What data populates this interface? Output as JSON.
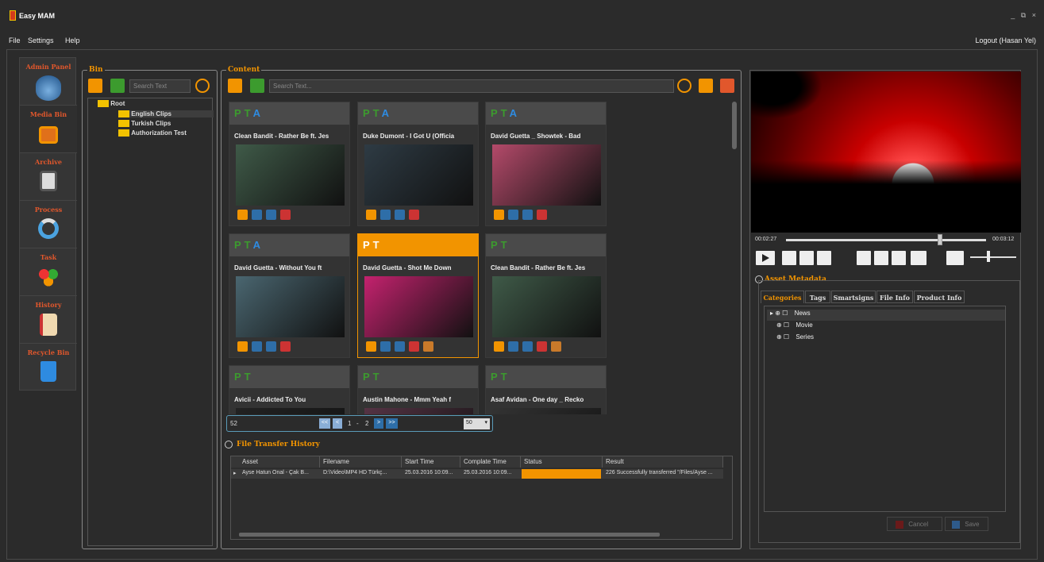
{
  "app": {
    "title": "Easy MAM",
    "window_controls": [
      "_",
      "⧉",
      "×"
    ]
  },
  "menu": {
    "items": [
      "File",
      "Settings",
      "Help"
    ],
    "logout": "Logout (Hasan Yel)"
  },
  "nav": {
    "items": [
      {
        "label": "Admin Panel",
        "icon": "admin-icon"
      },
      {
        "label": "Media Bin",
        "icon": "media-bin-icon"
      },
      {
        "label": "Archive",
        "icon": "archive-icon"
      },
      {
        "label": "Process",
        "icon": "process-icon"
      },
      {
        "label": "Task",
        "icon": "task-icon"
      },
      {
        "label": "History",
        "icon": "history-icon"
      },
      {
        "label": "Recycle Bin",
        "icon": "trash-icon"
      }
    ]
  },
  "bin": {
    "title": "Bin",
    "search_placeholder": "Search Text",
    "tree": {
      "root": "Root",
      "children": [
        "English Clips",
        "Turkish Clips",
        "Authorization Test"
      ]
    }
  },
  "content": {
    "title": "Content",
    "search_placeholder": "Search Text...",
    "cards": [
      {
        "flags": [
          "P",
          "T",
          "A"
        ],
        "title": "Clean Bandit - Rather Be ft. Jes",
        "thumb_color": "#3f5a48",
        "icons": 4
      },
      {
        "flags": [
          "P",
          "T",
          "A"
        ],
        "title": "Duke Dumont - I Got U (Officia",
        "thumb_color": "#2e3b44",
        "icons": 4
      },
      {
        "flags": [
          "P",
          "T",
          "A"
        ],
        "title": "David Guetta _ Showtek - Bad",
        "thumb_color": "#b44a6a",
        "icons": 4
      },
      {
        "flags": [
          "P",
          "T",
          "A"
        ],
        "title": "David Guetta - Without You ft",
        "thumb_color": "#4a6670",
        "icons": 4
      },
      {
        "flags": [
          "P",
          "T"
        ],
        "title": "David Guetta - Shot Me Down",
        "thumb_color": "#c4226e",
        "icons": 5,
        "selected": true
      },
      {
        "flags": [
          "P",
          "T"
        ],
        "title": "Clean Bandit - Rather Be ft. Jes",
        "thumb_color": "#3f5a48",
        "icons": 5
      },
      {
        "flags": [
          "P",
          "T"
        ],
        "title": "Avicii - Addicted To You",
        "thumb_color": "#222",
        "icons": 0
      },
      {
        "flags": [
          "P",
          "T"
        ],
        "title": "Austin Mahone - Mmm Yeah f",
        "thumb_color": "#553344",
        "icons": 0
      },
      {
        "flags": [
          "P",
          "T"
        ],
        "title": "Asaf Avidan - One day _ Recko",
        "thumb_color": "#333",
        "icons": 0
      }
    ],
    "pager": {
      "total": "52",
      "first": "<<",
      "prev": "<",
      "page_from": "1",
      "sep": "-",
      "page_to": "2",
      "next": ">",
      "last": ">>",
      "page_size": "50"
    }
  },
  "transfer": {
    "title": "File Transfer History",
    "columns": [
      "Asset",
      "Filename",
      "Start Time",
      "Complate Time",
      "Status",
      "Result"
    ],
    "rows": [
      {
        "asset": "Ayse Hatun Onal - Çak B...",
        "filename": "D:\\Video\\MP4 HD Türkç...",
        "start": "25.03.2016 10:09...",
        "complete": "25.03.2016 10:09...",
        "status_color": "#f29400",
        "result": "226 Successfully transferred \"/Files/Ayse ..."
      }
    ]
  },
  "player": {
    "time_current": "00:02:27",
    "time_total": "00:03:12",
    "progress": 0.77,
    "volume": 0.4
  },
  "metadata": {
    "title": "Asset Metadata",
    "tabs": [
      "Categories",
      "Tags",
      "Smartsigns",
      "File Info",
      "Product Info"
    ],
    "active_tab": "Categories",
    "categories": [
      "News",
      "Movie",
      "Series"
    ],
    "cancel": "Cancel",
    "save": "Save"
  },
  "colors": {
    "accent": "#f29400",
    "nav_label": "#e1572c",
    "green": "#3c9b2e",
    "blue": "#2e8be0"
  }
}
